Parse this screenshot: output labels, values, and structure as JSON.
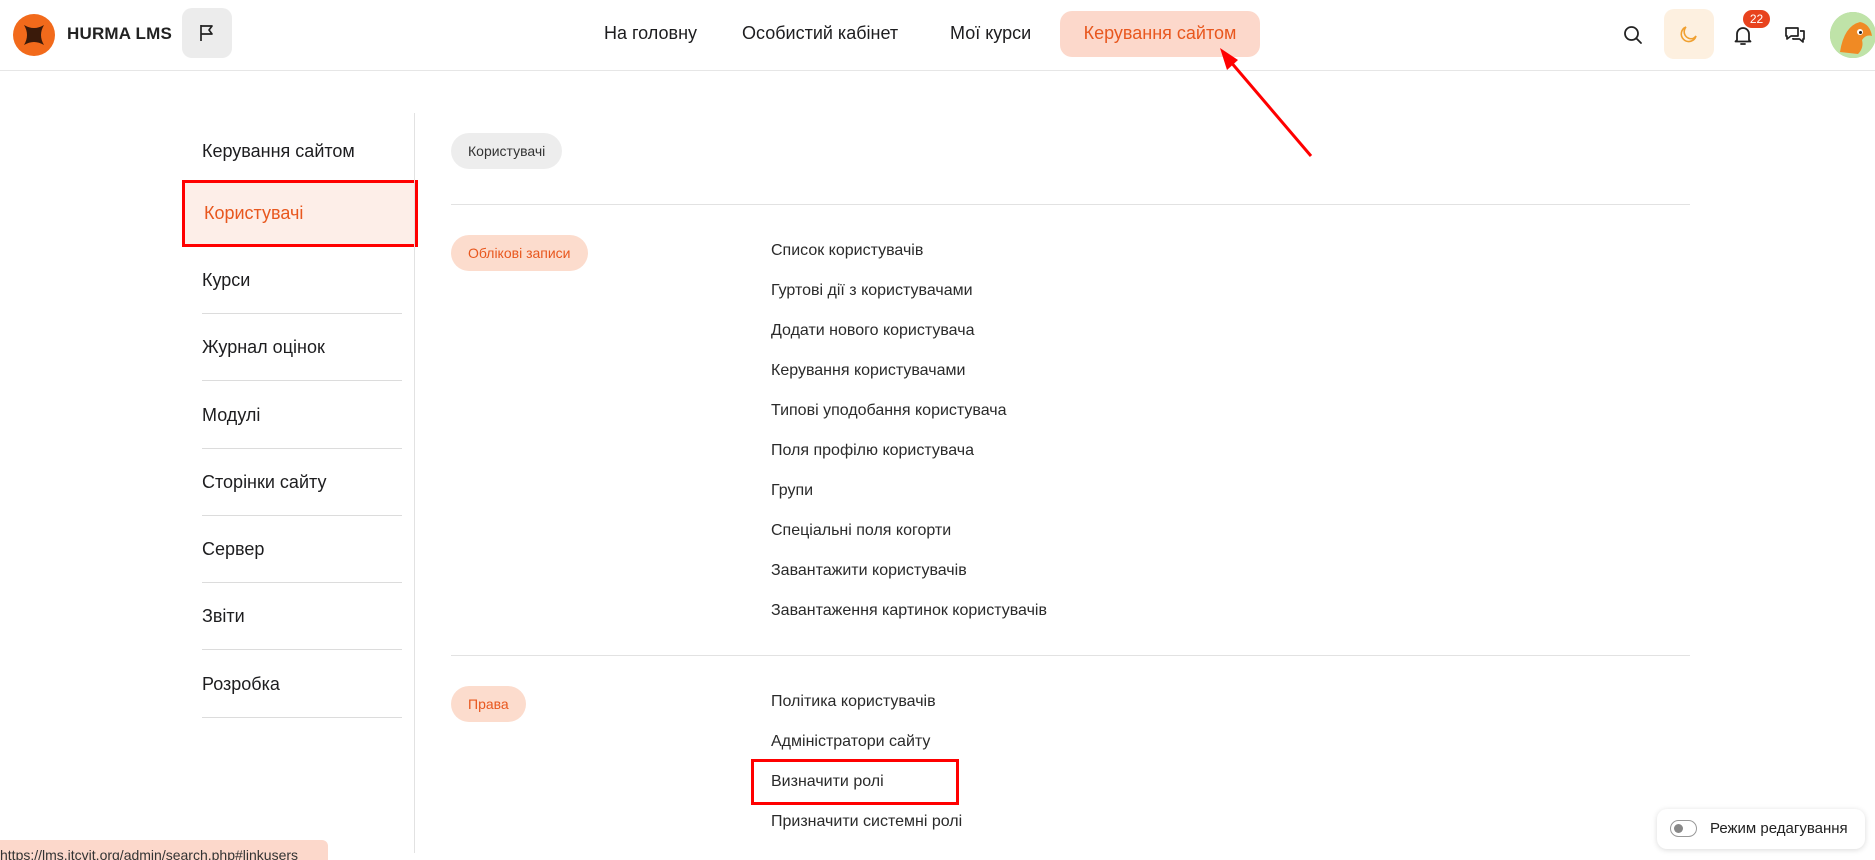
{
  "header": {
    "brand": "HURMA LMS",
    "nav": [
      "На головну",
      "Особистий кабінет",
      "Мої курси"
    ],
    "nav_active": "Керування сайтом",
    "notifications_count": "22",
    "colors": {
      "accent": "#e8571e",
      "accent_bg": "#fcd8cb"
    },
    "icons": [
      "logo-icon",
      "flag-icon",
      "search-icon",
      "moon-icon",
      "bell-icon",
      "chat-icon",
      "avatar"
    ]
  },
  "sidebar": {
    "items": [
      "Керування сайтом",
      "Користувачі",
      "Курси",
      "Журнал оцінок",
      "Модулі",
      "Сторінки сайту",
      "Сервер",
      "Звіти",
      "Розробка"
    ],
    "active": "Користувачі"
  },
  "main": {
    "breadcrumb": "Користувачі",
    "sections": [
      {
        "title": "Облікові записи",
        "links": [
          "Список користувачів",
          "Гуртові дії з користувачами",
          "Додати нового користувача",
          "Керування користувачами",
          "Типові уподобання користувача",
          "Поля профілю користувача",
          "Групи",
          "Спеціальні поля когорти",
          "Завантажити користувачів",
          "Завантаження картинок користувачів"
        ]
      },
      {
        "title": "Права",
        "links": [
          "Політика користувачів",
          "Адміністратори сайту",
          "Визначити ролі",
          "Призначити системні ролі"
        ]
      }
    ]
  },
  "footer": {
    "status_url": "https://lms.itcvit.org/admin/search.php#linkusers",
    "edit_mode_label": "Режим редагування"
  }
}
